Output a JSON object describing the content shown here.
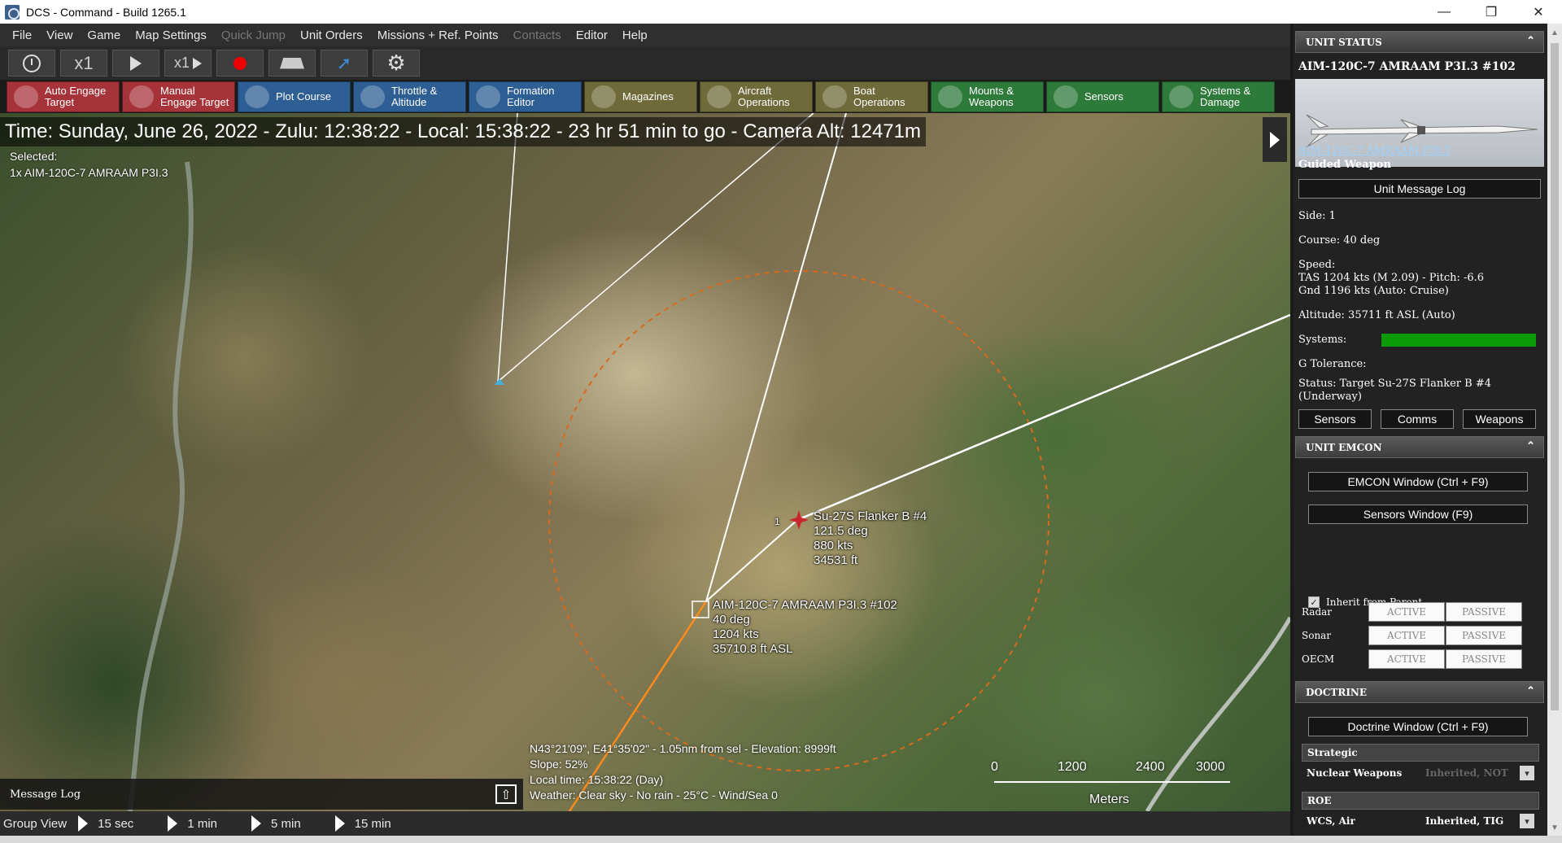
{
  "window": {
    "title": "DCS - Command - Build 1265.1",
    "controls": [
      "—",
      "❐",
      "✕"
    ]
  },
  "menu": [
    "File",
    "View",
    "Game",
    "Map Settings",
    "Quick Jump",
    "Unit Orders",
    "Missions + Ref. Points",
    "Contacts",
    "Editor",
    "Help"
  ],
  "menu_disabled": [
    "Quick Jump",
    "Contacts"
  ],
  "toolbar1": {
    "speed1": "x1",
    "speed2": "x1"
  },
  "toolbar2": [
    {
      "label1": "Auto Engage",
      "label2": "Target",
      "color": "#a7333a",
      "icon": "crosshair-icon"
    },
    {
      "label1": "Manual",
      "label2": "Engage Target",
      "color": "#a7333a",
      "icon": "crosshair-icon"
    },
    {
      "label1": "Plot Course",
      "label2": "",
      "color": "#2d5f94",
      "icon": "course-icon"
    },
    {
      "label1": "Throttle &",
      "label2": "Altitude",
      "color": "#2d5f94",
      "icon": "throttle-icon"
    },
    {
      "label1": "Formation",
      "label2": "Editor",
      "color": "#2d5f94",
      "icon": "formation-icon"
    },
    {
      "label1": "Magazines",
      "label2": "",
      "color": "#6e6a3a",
      "icon": "magazine-icon"
    },
    {
      "label1": "Aircraft",
      "label2": "Operations",
      "color": "#6e6a3a",
      "icon": "aircraft-icon"
    },
    {
      "label1": "Boat",
      "label2": "Operations",
      "color": "#6e6a3a",
      "icon": "boat-icon"
    },
    {
      "label1": "Mounts &",
      "label2": "Weapons",
      "color": "#2e7a3a",
      "icon": "mounts-icon"
    },
    {
      "label1": "Sensors",
      "label2": "",
      "color": "#2e7a3a",
      "icon": "sensors-icon"
    },
    {
      "label1": "Systems &",
      "label2": "Damage",
      "color": "#2e7a3a",
      "icon": "systems-icon"
    }
  ],
  "map": {
    "timebar": "Time: Sunday, June 26, 2022 - Zulu: 12:38:22 - Local: 15:38:22 - 23 hr 51 min to go -  Camera Alt: 12471m",
    "selected_label": "Selected:",
    "selected_value": "1x AIM-120C-7 AMRAAM P3I.3",
    "target": {
      "name": "Su-27S Flanker B #4",
      "course": "121.5 deg",
      "speed": "880 kts",
      "alt": "34531 ft",
      "count": "1"
    },
    "missile": {
      "name": "AIM-120C-7 AMRAAM P3I.3 #102",
      "course": "40 deg",
      "speed": "1204 kts",
      "alt": "35710.8 ft ASL"
    },
    "cursor": {
      "line1": "N43°21'09\", E41°35'02\" - 1.05nm from sel - Elevation: 8999ft",
      "line2": "Slope: 52%",
      "line3": "Local time: 15:38:22 (Day)",
      "line4": "Weather: Clear sky - No rain - 25°C - Wind/Sea 0"
    },
    "scale": {
      "ticks": [
        "0",
        "1200",
        "2400",
        "3000"
      ],
      "unit": "Meters"
    }
  },
  "message_log": "Message Log",
  "bottom": {
    "group_view": "Group View",
    "steps": [
      "15 sec",
      "1 min",
      "5 min",
      "15 min"
    ]
  },
  "panel": {
    "unit_status_header": "UNIT STATUS",
    "unit_name": "AIM-120C-7 AMRAAM P3I.3 #102",
    "unit_class_link": "AIM-120C-7 AMRAAM P3I.3",
    "unit_type": "Guided Weapon",
    "msg_log_btn": "Unit Message Log",
    "side": "Side: 1",
    "course": "Course: 40 deg",
    "speed_label": "Speed:",
    "speed_tas": "TAS 1204 kts (M 2.09) - Pitch: -6.6",
    "speed_gnd": "Gnd 1196 kts (Auto: Cruise)",
    "altitude": "Altitude: 35711 ft ASL (Auto)",
    "systems": "Systems:",
    "g_tolerance": "G Tolerance:",
    "status1": "Status: Target Su-27S Flanker B #4",
    "status2": "(Underway)",
    "btn_sensors": "Sensors",
    "btn_comms": "Comms",
    "btn_weapons": "Weapons",
    "emcon_header": "UNIT EMCON",
    "emcon_window": "EMCON Window (Ctrl + F9)",
    "sensors_window": "Sensors Window (F9)",
    "inherit": "Inherit from Parent",
    "emcon_rows": [
      {
        "label": "Radar",
        "active": "ACTIVE",
        "passive": "PASSIVE"
      },
      {
        "label": "Sonar",
        "active": "ACTIVE",
        "passive": "PASSIVE"
      },
      {
        "label": "OECM",
        "active": "ACTIVE",
        "passive": "PASSIVE"
      }
    ],
    "doctrine_header": "DOCTRINE",
    "doctrine_window": "Doctrine Window (Ctrl + F9)",
    "strategic": "Strategic",
    "nuclear_k": "Nuclear Weapons",
    "nuclear_v": "Inherited, NOT",
    "roe": "ROE",
    "wcs_k": "WCS, Air",
    "wcs_v": "Inherited, TIG",
    "systems_color": "#0a9a0a"
  }
}
